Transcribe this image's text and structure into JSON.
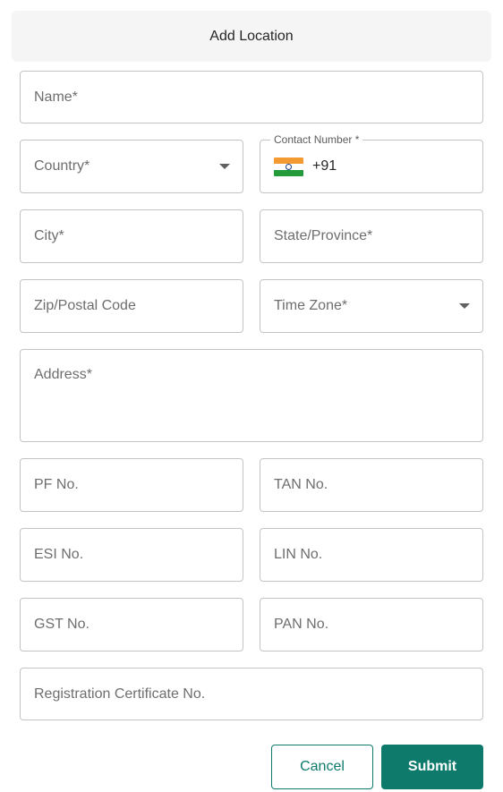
{
  "header": {
    "title": "Add Location"
  },
  "form": {
    "name": {
      "placeholder": "Name*"
    },
    "country": {
      "placeholder": "Country*"
    },
    "contact": {
      "label": "Contact Number *",
      "dial_code": "+91",
      "flag": "india-flag-icon"
    },
    "city": {
      "placeholder": "City*"
    },
    "state": {
      "placeholder": "State/Province*"
    },
    "zip": {
      "placeholder": "Zip/Postal Code"
    },
    "timezone": {
      "placeholder": "Time Zone*"
    },
    "address": {
      "placeholder": "Address*"
    },
    "pf": {
      "placeholder": "PF No."
    },
    "tan": {
      "placeholder": "TAN No."
    },
    "esi": {
      "placeholder": "ESI No."
    },
    "lin": {
      "placeholder": "LIN No."
    },
    "gst": {
      "placeholder": "GST No."
    },
    "pan": {
      "placeholder": "PAN No."
    },
    "registration": {
      "placeholder": "Registration Certificate No."
    }
  },
  "actions": {
    "cancel_label": "Cancel",
    "submit_label": "Submit"
  },
  "colors": {
    "accent": "#0d7a6c",
    "border": "#c4c4c4",
    "header_bg": "#f5f5f5"
  }
}
